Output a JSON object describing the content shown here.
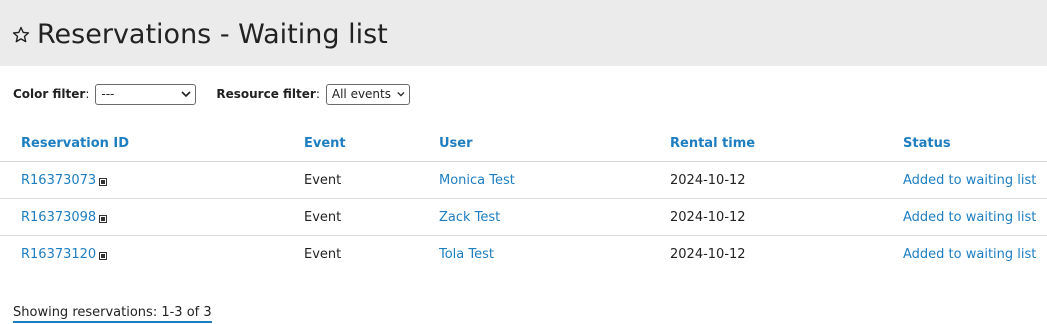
{
  "header": {
    "title": "Reservations - Waiting list",
    "icon": "star-outline-icon"
  },
  "filters": {
    "color": {
      "label": "Color filter",
      "value": "---"
    },
    "resource": {
      "label": "Resource filter",
      "value": "All events"
    }
  },
  "table": {
    "columns": [
      "Reservation ID",
      "Event",
      "User",
      "Rental time",
      "Status"
    ],
    "rows": [
      {
        "id": "R16373073",
        "event": "Event",
        "user": "Monica Test",
        "rental_time": "2024-10-12",
        "status": "Added to waiting list"
      },
      {
        "id": "R16373098",
        "event": "Event",
        "user": "Zack Test",
        "rental_time": "2024-10-12",
        "status": "Added to waiting list"
      },
      {
        "id": "R16373120",
        "event": "Event",
        "user": "Tola Test",
        "rental_time": "2024-10-12",
        "status": "Added to waiting list"
      }
    ]
  },
  "footer": {
    "summary": "Showing reservations: 1-3 of 3"
  },
  "colors": {
    "link": "#1e7ec0",
    "header_bg": "#ebebeb"
  }
}
